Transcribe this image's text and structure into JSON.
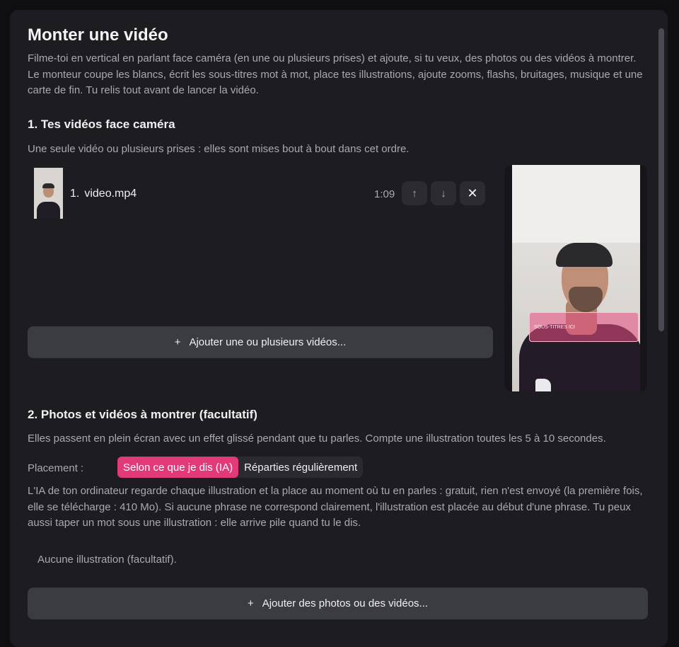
{
  "title": "Monter une vidéo",
  "intro": "Filme-toi en vertical en parlant face caméra (en une ou plusieurs prises) et ajoute, si tu veux, des photos ou des vidéos à montrer. Le monteur coupe les blancs, écrit les sous-titres mot à mot, place tes illustrations, ajoute zooms, flashs, bruitages, musique et une carte de fin. Tu relis tout avant de lancer la vidéo.",
  "section1": {
    "title": "1.  Tes vidéos face caméra",
    "description": "Une seule vidéo ou plusieurs prises : elles sont mises bout à bout dans cet ordre.",
    "videos": [
      {
        "index": "1.",
        "name": "video.mp4",
        "duration": "1:09",
        "up_icon": "↑",
        "down_icon": "↓",
        "remove_icon": "✕"
      }
    ],
    "add_button": {
      "icon": "+",
      "label": "Ajouter une ou plusieurs vidéos..."
    }
  },
  "preview": {
    "subtitle_placeholder": "SOUS-TITRES ICI",
    "subtitle_color": "#e94c82"
  },
  "section2": {
    "title": "2.  Photos et vidéos à montrer (facultatif)",
    "description": "Elles passent en plein écran avec un effet glissé pendant que tu parles. Compte une illustration toutes les 5 à 10 secondes.",
    "placement_label": "Placement :",
    "placement_options": [
      "Selon ce que je dis (IA)",
      "Réparties régulièrement"
    ],
    "placement_selected": "Selon ce que je dis (IA)",
    "ai_text": "L'IA de ton ordinateur regarde chaque illustration et la place au moment où tu en parles : gratuit, rien n'est envoyé (la première fois, elle se télécharge : 410 Mo). Si aucune phrase ne correspond clairement, l'illustration est placée au début d'une phrase. Tu peux aussi taper un mot sous une illustration : elle arrive pile quand tu le dis.",
    "empty_text": "Aucune illustration (facultatif).",
    "add_button": {
      "icon": "+",
      "label": "Ajouter des photos ou des vidéos..."
    }
  },
  "colors": {
    "accent": "#e23a79",
    "panel": "#1c1c21",
    "button": "#3b3b42"
  }
}
